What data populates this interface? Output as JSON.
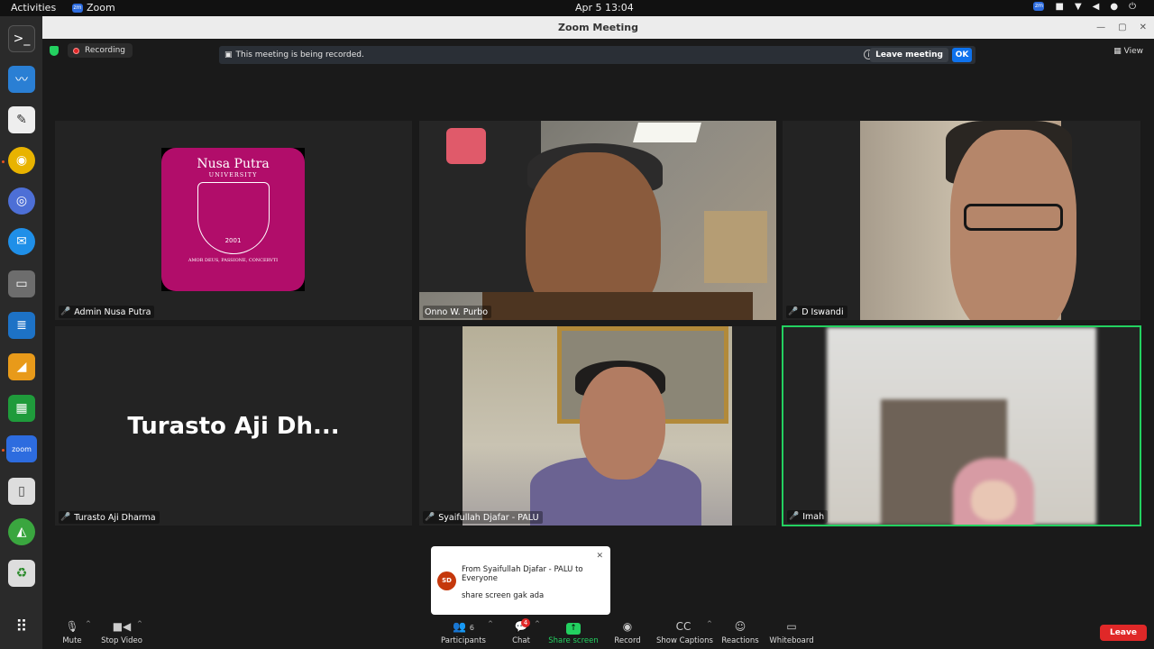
{
  "system": {
    "activities": "Activities",
    "app_name": "Zoom",
    "datetime": "Apr 5  13:04"
  },
  "window": {
    "title": "Zoom Meeting"
  },
  "recording": {
    "label": "Recording",
    "banner_text": "This meeting is being recorded.",
    "leave_label": "Leave meeting",
    "ok_label": "OK"
  },
  "view_label": "View",
  "participants": [
    {
      "name": "Admin Nusa Putra",
      "muted": true
    },
    {
      "name": "Onno W. Purbo",
      "muted": false
    },
    {
      "name": "D Iswandi",
      "muted": true
    },
    {
      "name": "Turasto Aji Dharma",
      "muted": true,
      "display": "Turasto Aji Dh..."
    },
    {
      "name": "Syaifullah Djafar - PALU",
      "muted": true
    },
    {
      "name": "Imah",
      "muted": true
    }
  ],
  "logo": {
    "title": "Nusa Putra",
    "subtitle": "UNIVERSITY",
    "year": "2001",
    "motto": "AMOR DEUS, PASSIONE, CONCERVTI"
  },
  "chat_toast": {
    "avatar_initials": "SD",
    "from": "From Syaifullah Djafar - PALU to Everyone",
    "message": "share screen gak ada"
  },
  "toolbar": {
    "mute": "Mute",
    "stop_video": "Stop Video",
    "participants": "Participants",
    "participant_count": "6",
    "chat": "Chat",
    "chat_badge": "4",
    "share_screen": "Share screen",
    "record": "Record",
    "show_captions": "Show Captions",
    "reactions": "Reactions",
    "whiteboard": "Whiteboard",
    "leave": "Leave"
  }
}
